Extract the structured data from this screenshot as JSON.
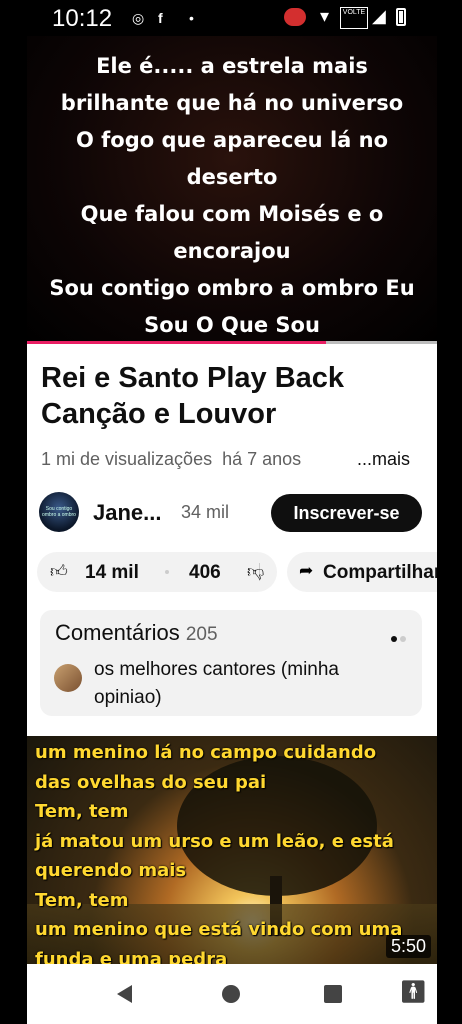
{
  "status_bar": {
    "time": "10:12",
    "icons": [
      "target-icon",
      "facebook-icon",
      "dot-icon",
      "record-icon",
      "wifi-icon",
      "volte-icon",
      "signal-icon",
      "battery-icon"
    ],
    "volte_text": "VOLTE"
  },
  "video_top": {
    "lyrics": [
      "Ele é..... a estrela mais",
      "brilhante que há no universo",
      "O fogo que apareceu lá no",
      "deserto",
      "Que falou com Moisés e o",
      "encorajou",
      "Sou contigo ombro a ombro Eu",
      "Sou O Que Sou"
    ],
    "progress": 0.73
  },
  "video_info": {
    "title": "Rei e Santo Play Back Canção e Louvor",
    "views": "1 mi de visualizações",
    "age": "há 7 anos",
    "more_label": "...mais"
  },
  "channel": {
    "name": "Jane...",
    "subscribers": "34 mil",
    "subscribe_label": "Inscrever-se",
    "avatar_text": "Sou contigo ombro a ombro"
  },
  "actions": {
    "likes": "14 mil",
    "dislikes": "406",
    "share_label": "Compartilhar"
  },
  "comments": {
    "heading": "Comentários",
    "count": "205",
    "preview": "os melhores cantores (minha opiniao)"
  },
  "next_video": {
    "lyrics": [
      "um menino lá no campo cuidando",
      "das ovelhas do seu pai",
      "Tem, tem",
      "já matou um urso e um leão, e está",
      "querendo mais",
      "Tem, tem",
      "um menino que está vindo com uma",
      "funda e uma pedra"
    ],
    "duration": "5:50"
  },
  "colors": {
    "progress_fill": "#e91e63",
    "subscribe_bg": "#0f0f0f",
    "lyrics_yellow": "#ffd830"
  }
}
